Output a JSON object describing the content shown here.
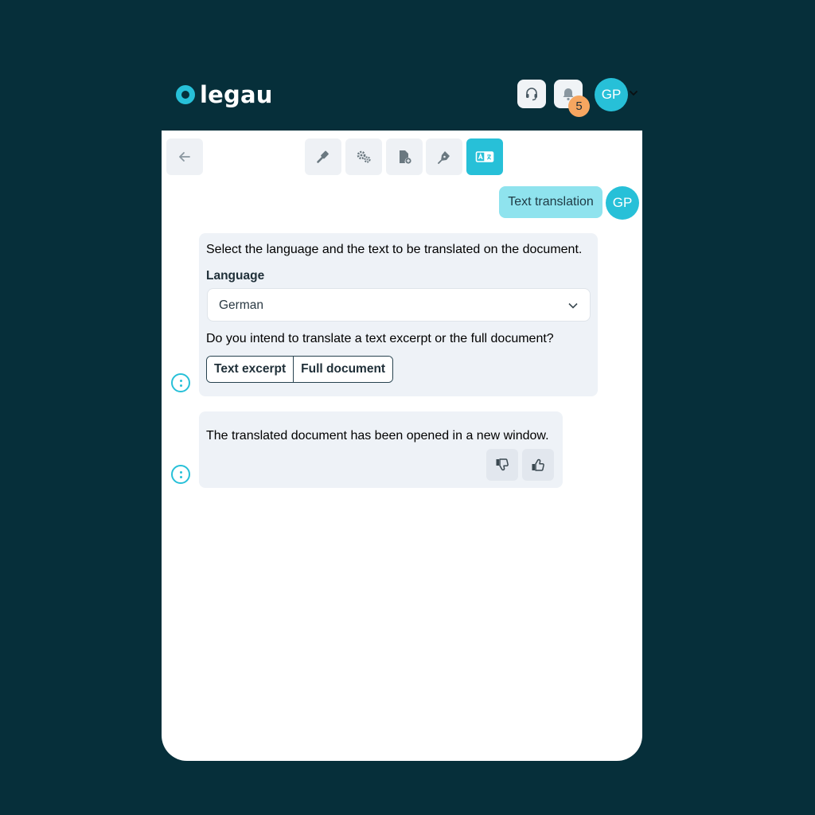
{
  "brand": {
    "name": "legau"
  },
  "header": {
    "notification_count": "5",
    "user_initials": "GP",
    "icons": [
      "headset-icon",
      "bell-icon",
      "chevron-down-icon"
    ]
  },
  "toolbar": {
    "items": [
      "back-arrow-icon",
      "gavel-icon",
      "gears-icon",
      "document-add-icon",
      "pen-nib-icon",
      "translate-icon"
    ],
    "active": "translate-icon"
  },
  "chat": {
    "user_message": "Text translation",
    "user_initials": "GP",
    "bot_message_1": {
      "intro": "Select the language and the text to be translated on the document.",
      "language_label": "Language",
      "language_value": "German",
      "question": "Do you intend to translate a text excerpt or the full document?",
      "options": [
        "Text excerpt",
        "Full document"
      ]
    },
    "bot_message_2": {
      "text": "The translated document has been opened in a new window."
    }
  },
  "colors": {
    "background": "#062f3a",
    "accent": "#27c0d8",
    "badge": "#f6a660",
    "user_bubble": "#8fe3ee",
    "bot_bubble": "#eef2f7"
  }
}
